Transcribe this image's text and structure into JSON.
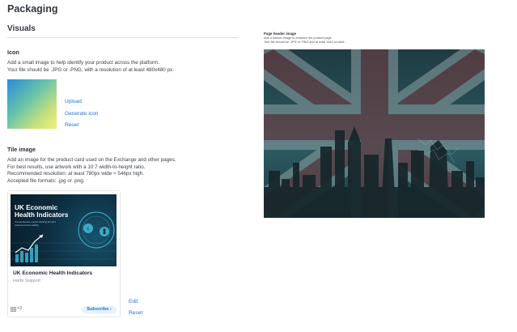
{
  "page": {
    "title": "Packaging"
  },
  "visuals": {
    "title": "Visuals",
    "icon": {
      "heading": "Icon",
      "desc_line1": "Add a small image to help identify your product across the platform.",
      "desc_line2": "Your file should be .JPG or .PNG, with a resolution of at least 480x480 px.",
      "upload_label": "Upload",
      "generate_label": "Generate icon",
      "reset_label": "Reset"
    },
    "tile": {
      "heading": "Tile image",
      "desc_line1": "Add an image for the product card used on the Exchange and other pages.",
      "desc_line2": "For best results, use artwork with a 10:7 width-to-height ratio.",
      "desc_line3": "Recommended resolution: at least 780px wide × 546px high.",
      "desc_line4": "Accepted file formats: .jpg or .png.",
      "art_title": "UK Economic Health Indicators",
      "art_subtitle": "Comprehensive metrics tracking the UK's macroeconomic stability",
      "card_title": "UK Economic Health Indicators",
      "card_vendor": "Harbr Support",
      "card_count": "×2",
      "subscribe_label": "Subscribe ›",
      "edit_label": "Edit",
      "reset_label": "Reset"
    },
    "header_image": {
      "label": "Page header image",
      "desc_line1": "Add a banner image to enhance the product page.",
      "desc_line2": "Your file should be .JPG or .PNG and at least 1440 px wide."
    }
  },
  "colors": {
    "link": "#1e78c8",
    "heading": "#333840",
    "divider": "#d9dce1",
    "subscribe_bg": "#e7f1fb"
  }
}
